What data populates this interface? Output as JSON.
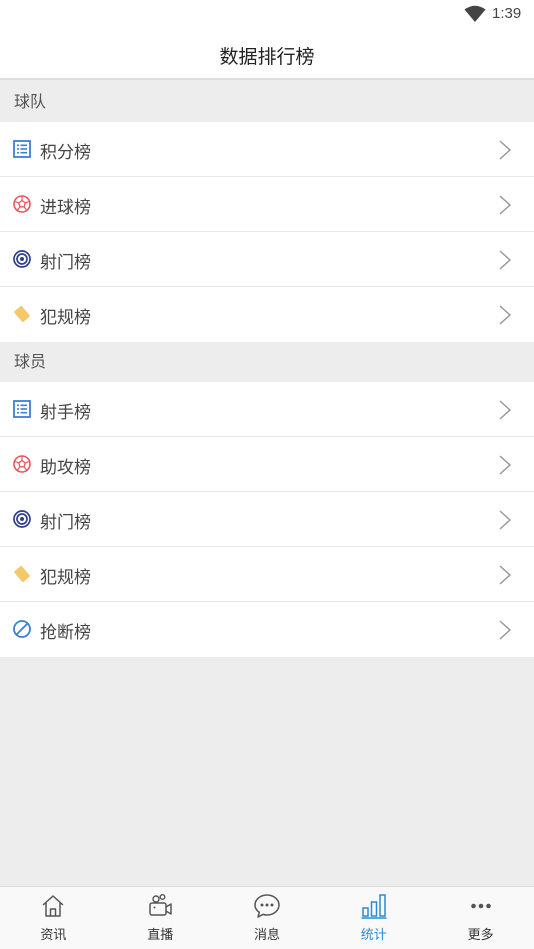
{
  "status_bar": {
    "time": "1:39"
  },
  "header": {
    "title": "数据排行榜"
  },
  "sections": [
    {
      "title": "球队",
      "items": [
        {
          "label": "积分榜",
          "icon": "table-list-icon"
        },
        {
          "label": "进球榜",
          "icon": "soccer-ball-icon"
        },
        {
          "label": "射门榜",
          "icon": "target-icon"
        },
        {
          "label": "犯规榜",
          "icon": "yellow-card-icon"
        }
      ]
    },
    {
      "title": "球员",
      "items": [
        {
          "label": "射手榜",
          "icon": "table-list-icon"
        },
        {
          "label": "助攻榜",
          "icon": "soccer-ball-icon"
        },
        {
          "label": "射门榜",
          "icon": "target-icon"
        },
        {
          "label": "犯规榜",
          "icon": "yellow-card-icon"
        },
        {
          "label": "抢断榜",
          "icon": "block-icon"
        }
      ]
    }
  ],
  "tabs": [
    {
      "label": "资讯",
      "icon": "home-icon",
      "active": false
    },
    {
      "label": "直播",
      "icon": "video-camera-icon",
      "active": false
    },
    {
      "label": "消息",
      "icon": "chat-bubble-icon",
      "active": false
    },
    {
      "label": "统计",
      "icon": "bar-chart-icon",
      "active": true
    },
    {
      "label": "更多",
      "icon": "more-dots-icon",
      "active": false
    }
  ],
  "colors": {
    "accent": "#2b8bd6",
    "list_icon_blue": "#3d7fd6",
    "ball_red": "#e8565c",
    "target_navy": "#2f3f8f",
    "card_yellow": "#f5c86a"
  }
}
